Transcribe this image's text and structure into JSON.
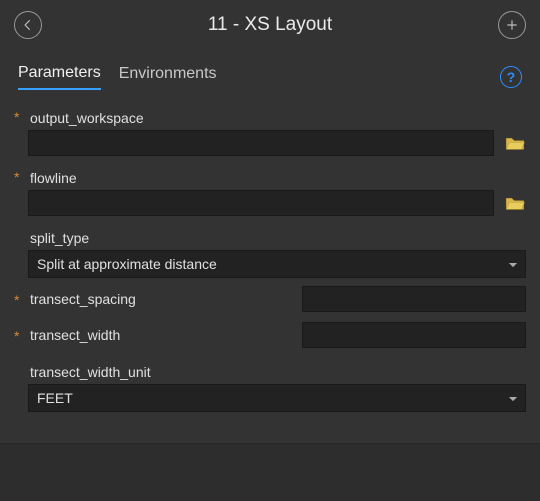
{
  "header": {
    "title": "11 - XS Layout"
  },
  "tabs": {
    "parameters": "Parameters",
    "environments": "Environments"
  },
  "help": {
    "symbol": "?"
  },
  "fields": {
    "output_workspace": {
      "label": "output_workspace",
      "value": "",
      "required": true
    },
    "flowline": {
      "label": "flowline",
      "value": "",
      "required": true
    },
    "split_type": {
      "label": "split_type",
      "value": "Split at approximate distance",
      "required": false
    },
    "transect_spacing": {
      "label": "transect_spacing",
      "value": "",
      "required": true
    },
    "transect_width": {
      "label": "transect_width",
      "value": "",
      "required": true
    },
    "transect_width_unit": {
      "label": "transect_width_unit",
      "value": "FEET",
      "required": false
    }
  },
  "required_marker": "*"
}
